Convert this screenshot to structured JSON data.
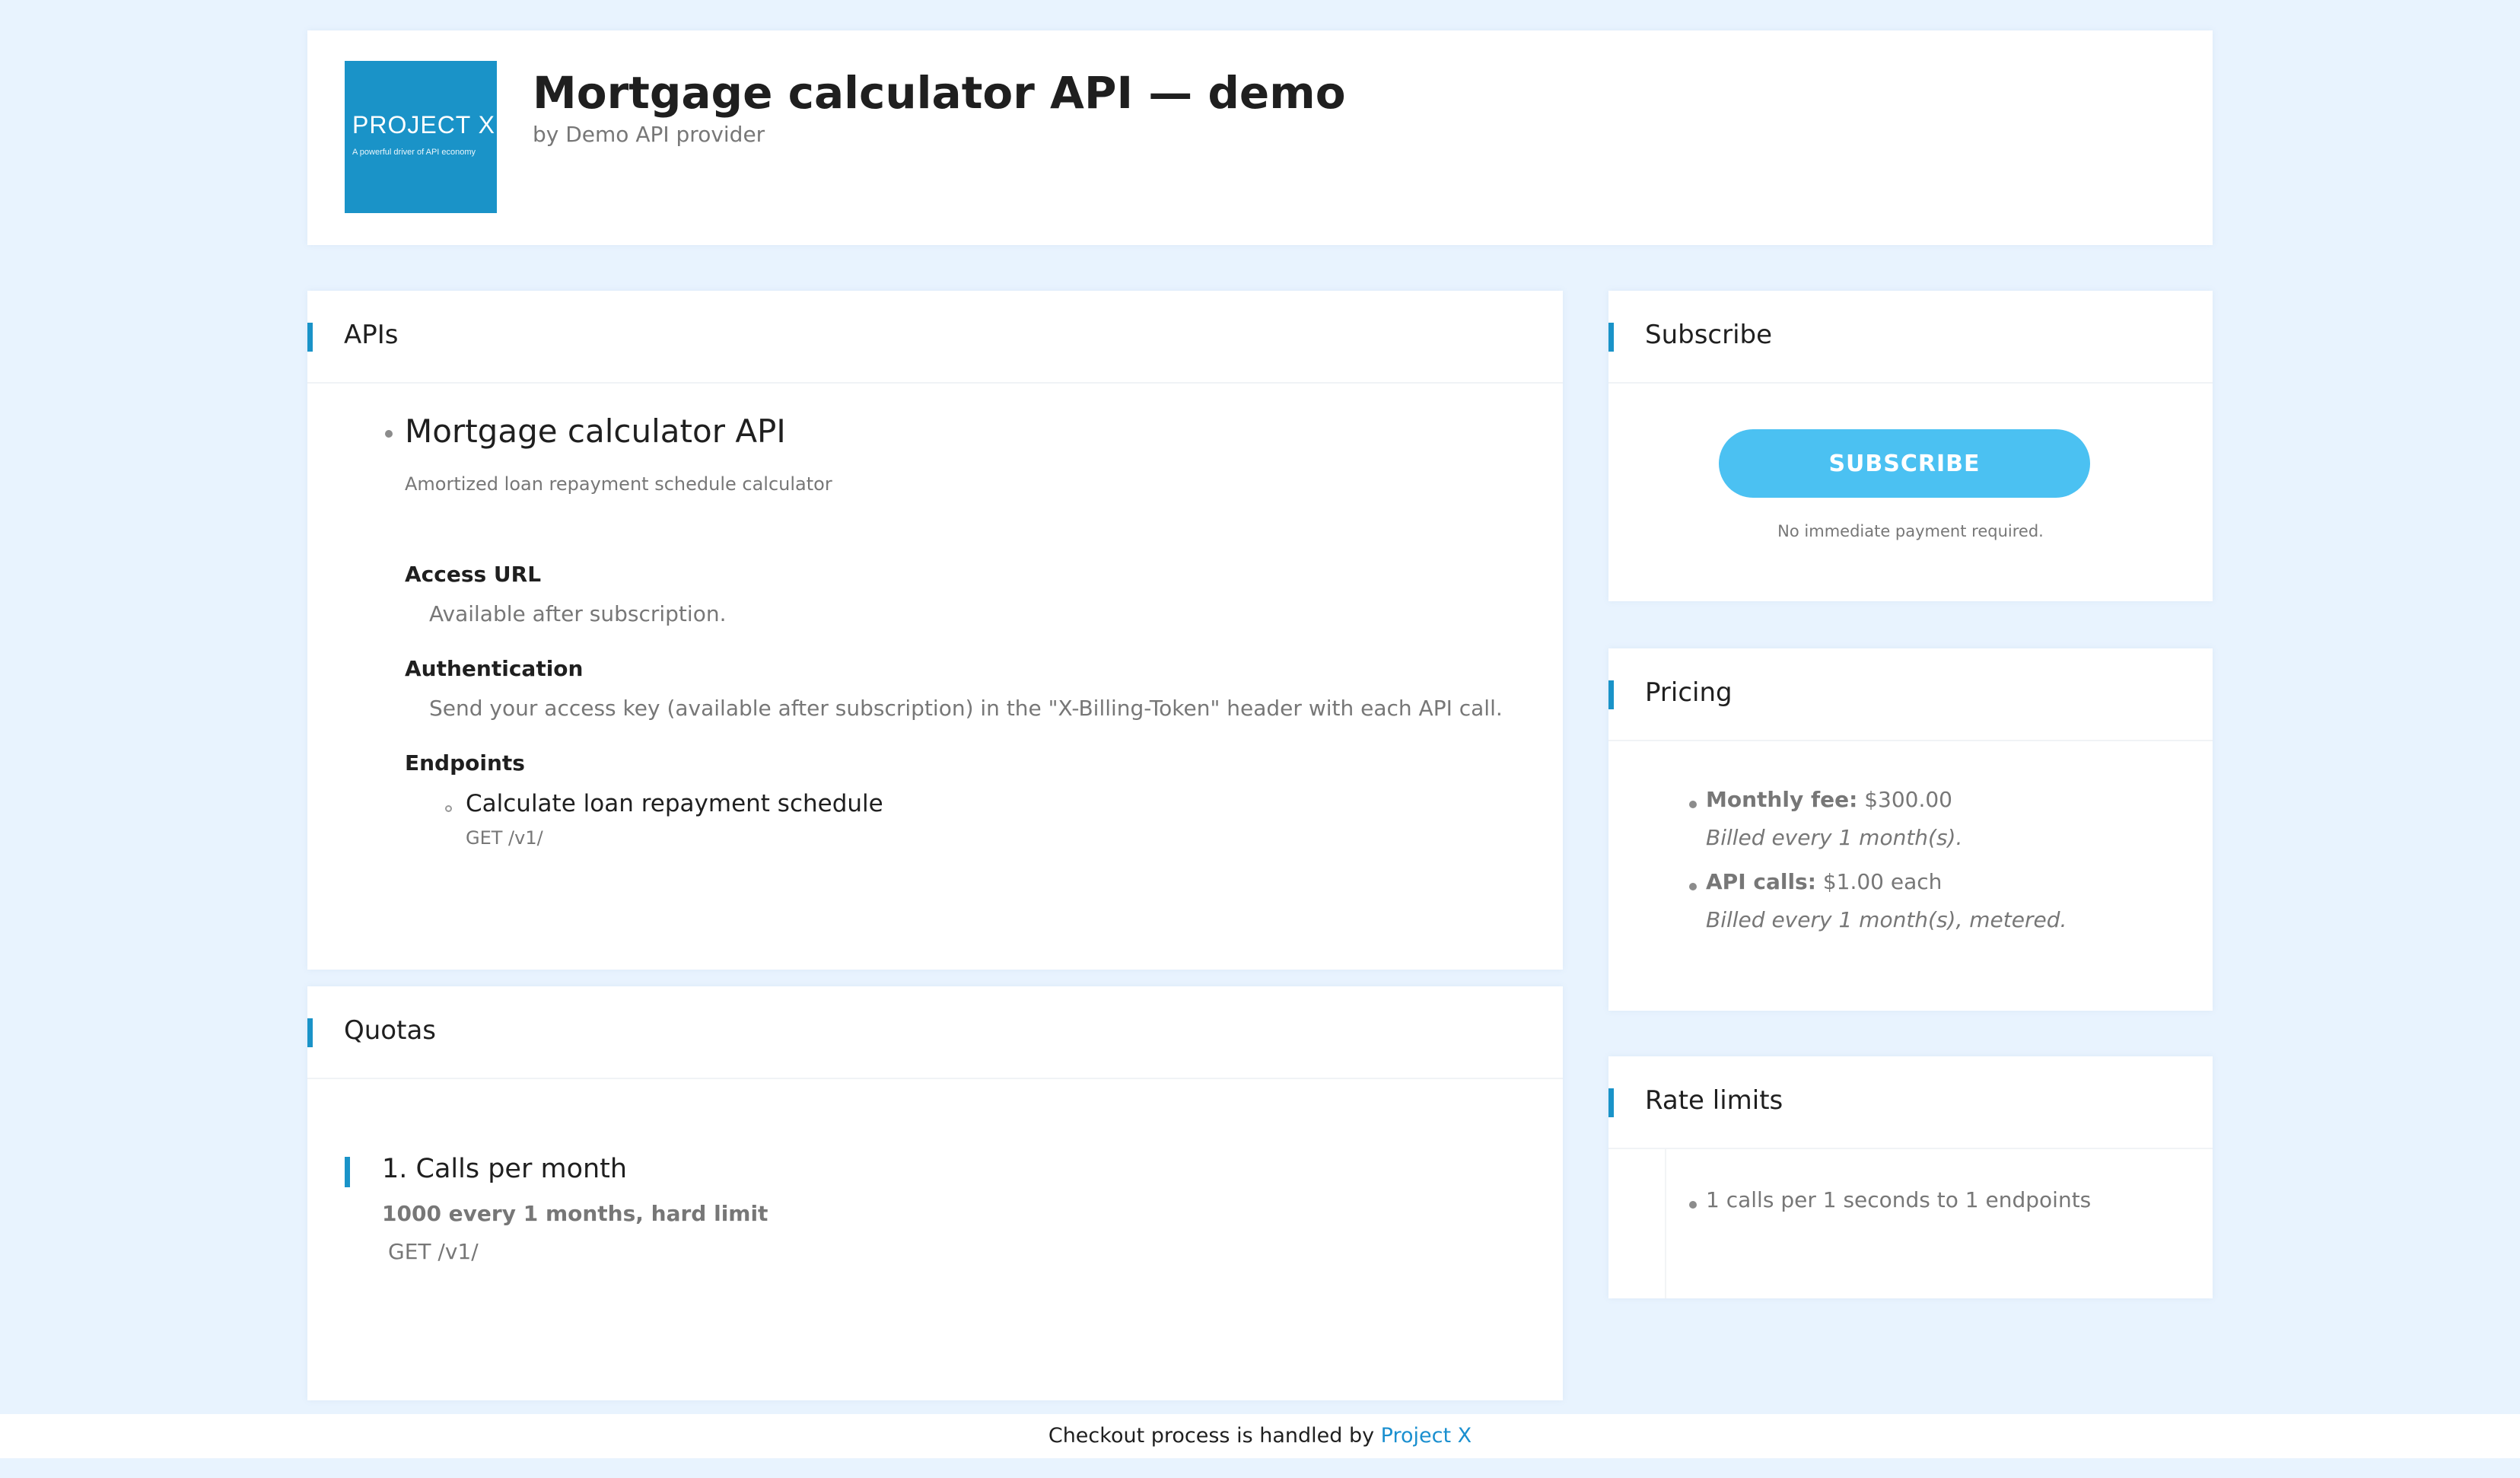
{
  "header": {
    "logo_title": "PROJECT X",
    "logo_subtitle": "A powerful driver of API economy",
    "title": "Mortgage calculator API — demo",
    "subtitle": "by Demo API provider"
  },
  "apis": {
    "heading": "APIs",
    "api": {
      "name": "Mortgage calculator API",
      "description": "Amortized loan repayment schedule calculator",
      "access_url_label": "Access URL",
      "access_url_value": "Available after subscription.",
      "auth_label": "Authentication",
      "auth_value": "Send your access key (available after subscription) in the \"X-Billing-Token\" header with each API call.",
      "endpoints_label": "Endpoints",
      "endpoints": [
        {
          "name": "Calculate loan repayment schedule",
          "path": "GET /v1/"
        }
      ]
    }
  },
  "quotas": {
    "heading": "Quotas",
    "items": [
      {
        "title": "1. Calls per month",
        "detail": "1000 every 1 months, hard limit",
        "path": "GET /v1/"
      }
    ]
  },
  "subscribe": {
    "heading": "Subscribe",
    "button_label": "SUBSCRIBE",
    "note": "No immediate payment required."
  },
  "pricing": {
    "heading": "Pricing",
    "items": [
      {
        "label": "Monthly fee:",
        "value": " $300.00",
        "note": "Billed every 1 month(s)."
      },
      {
        "label": "API calls:",
        "value": " $1.00 each",
        "note": "Billed every 1 month(s), metered."
      }
    ]
  },
  "rate_limits": {
    "heading": "Rate limits",
    "items": [
      "1 calls per 1 seconds to 1 endpoints"
    ]
  },
  "footer": {
    "text": "Checkout process is handled by ",
    "link_text": "Project X"
  },
  "colors": {
    "background": "#e8f3fe",
    "accent": "#1a93c8",
    "button": "#4bc1f2",
    "link": "#1a8fcf"
  }
}
